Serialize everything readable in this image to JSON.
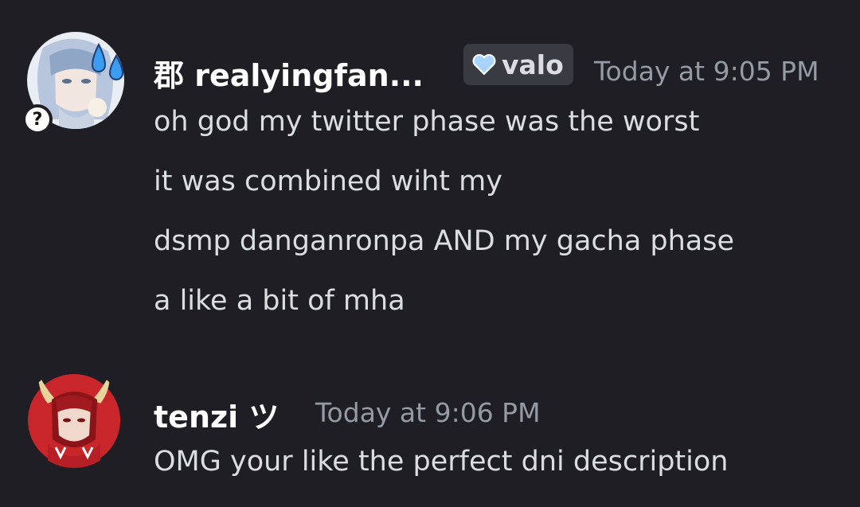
{
  "messages": [
    {
      "username": "郡 realyingfan...",
      "tag": {
        "label": "valo",
        "icon": "heart-icon",
        "icon_color": "#a8d4ff"
      },
      "timestamp": "Today at 9:05 PM",
      "lines": [
        "oh god my twitter phase was the worst",
        "it was combined wiht my",
        "dsmp danganronpa AND my gacha phase",
        "a like a bit of mha"
      ],
      "avatar_badge": "?"
    },
    {
      "username": "tenzi ツ",
      "timestamp": "Today at 9:06 PM",
      "lines": [
        "OMG your like the perfect dni description"
      ]
    }
  ]
}
